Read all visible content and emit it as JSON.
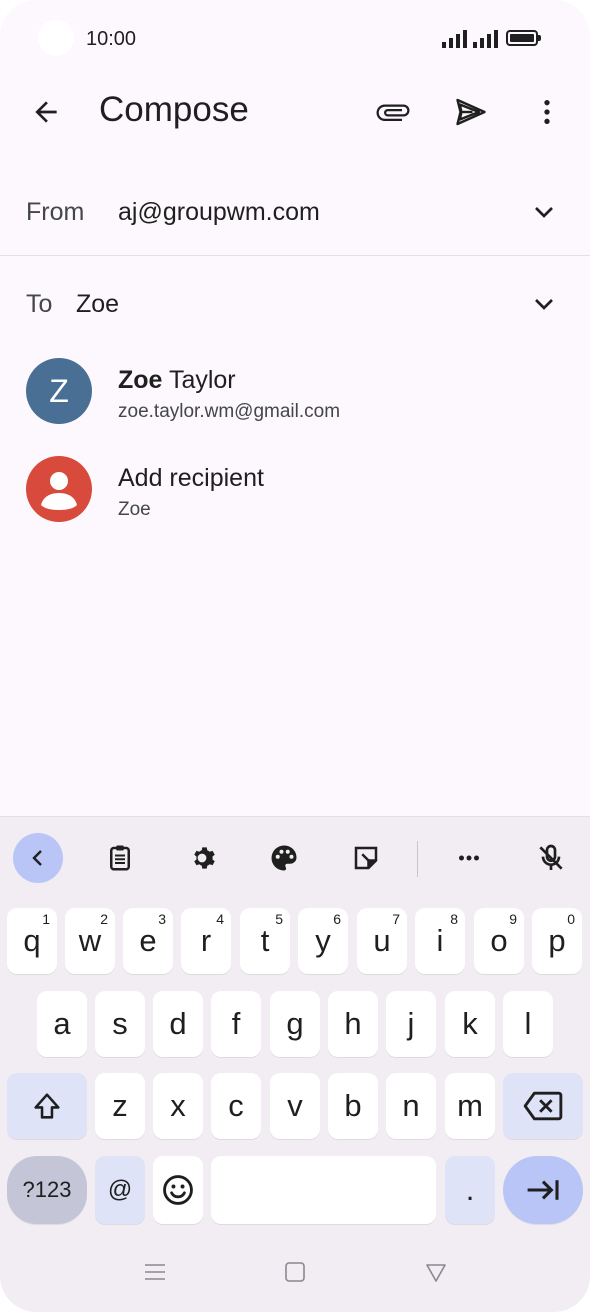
{
  "status_bar": {
    "time": "10:00"
  },
  "app_bar": {
    "title": "Compose",
    "back_icon": "arrow-left-icon",
    "attach_icon": "paperclip-icon",
    "send_icon": "send-icon",
    "more_icon": "more-vert-icon"
  },
  "from": {
    "label": "From",
    "value": "aj@groupwm.com"
  },
  "to": {
    "label": "To",
    "value": "Zoe"
  },
  "suggestions": [
    {
      "initial": "Z",
      "name_bold": "Zoe",
      "name_rest": " Taylor",
      "email": "zoe.taylor.wm@gmail.com",
      "avatar_color": "#4a6f95"
    },
    {
      "name": "Add recipient",
      "sub": "Zoe",
      "avatar_color": "#d84a3c"
    }
  ],
  "keyboard": {
    "toolbar_icons": [
      "chevron-left-icon",
      "clipboard-icon",
      "gear-icon",
      "palette-icon",
      "sticker-icon",
      "more-horiz-icon",
      "mic-off-icon"
    ],
    "row1": [
      {
        "letter": "q",
        "num": "1"
      },
      {
        "letter": "w",
        "num": "2"
      },
      {
        "letter": "e",
        "num": "3"
      },
      {
        "letter": "r",
        "num": "4"
      },
      {
        "letter": "t",
        "num": "5"
      },
      {
        "letter": "y",
        "num": "6"
      },
      {
        "letter": "u",
        "num": "7"
      },
      {
        "letter": "i",
        "num": "8"
      },
      {
        "letter": "o",
        "num": "9"
      },
      {
        "letter": "p",
        "num": "0"
      }
    ],
    "row2": [
      "a",
      "s",
      "d",
      "f",
      "g",
      "h",
      "j",
      "k",
      "l"
    ],
    "row3": [
      "z",
      "x",
      "c",
      "v",
      "b",
      "n",
      "m"
    ],
    "sym_label": "?123",
    "at_label": "@",
    "period_label": "."
  },
  "colors": {
    "background": "#fcf8fd",
    "keyboard_bg": "#f1edf3",
    "accent": "#b9c5f7"
  }
}
